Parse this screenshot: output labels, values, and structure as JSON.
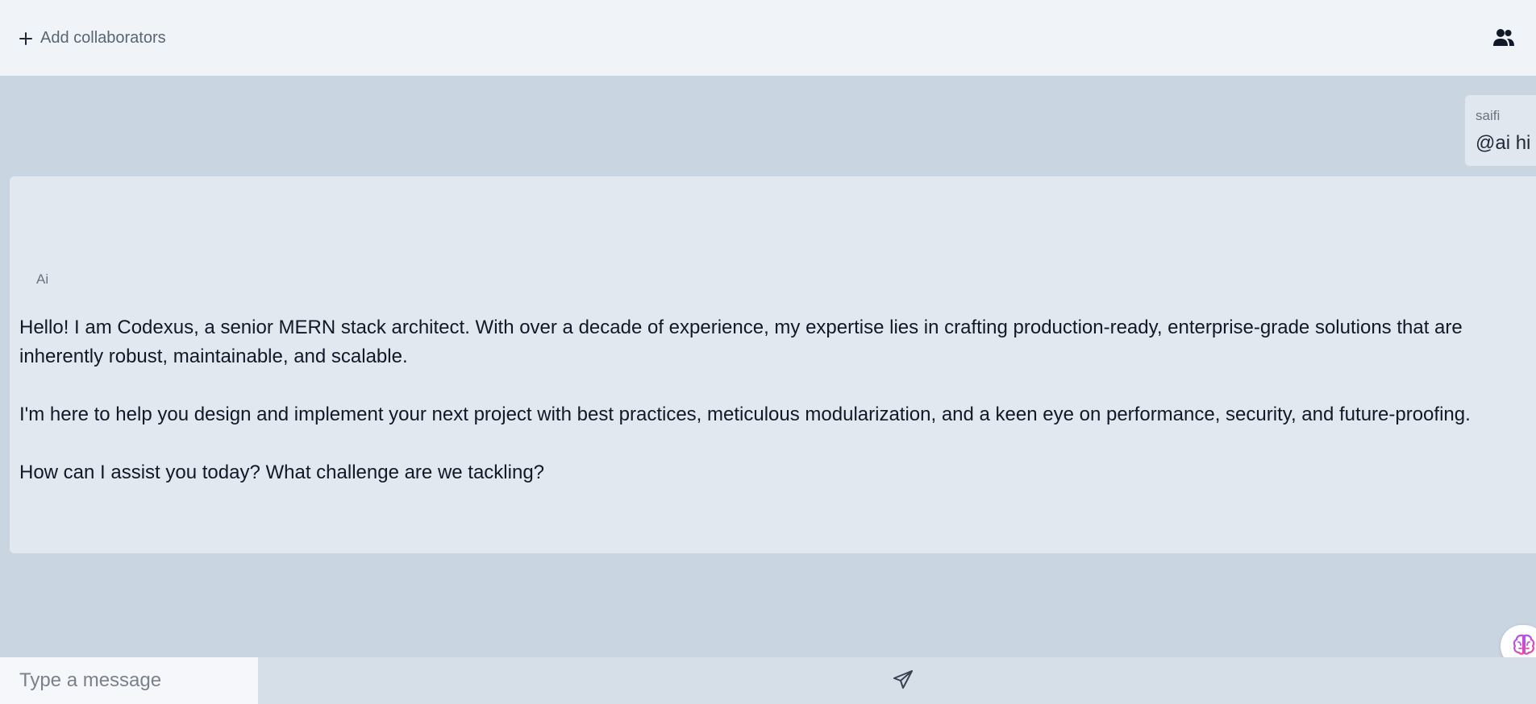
{
  "header": {
    "add_collaborators_label": "Add collaborators",
    "plus_icon": "plus-icon",
    "collaborators_icon": "people-icon"
  },
  "messages": {
    "user_message": {
      "sender": "saifi",
      "text": "@ai hi"
    },
    "ai_message": {
      "sender": "Ai",
      "paragraphs": [
        "Hello! I am Codexus, a senior MERN stack architect. With over a decade of experience, my expertise lies in crafting production-ready, enterprise-grade solutions that are inherently robust, maintainable, and scalable.",
        "I'm here to help you design and implement your next project with best practices, meticulous modularization, and a keen eye on performance, security, and future-proofing.",
        "How can I assist you today? What challenge are we tackling?"
      ]
    }
  },
  "footer": {
    "input_placeholder": "Type a message",
    "input_value": "",
    "send_icon": "send-icon"
  },
  "ai_assistant_icon": "brain-icon",
  "colors": {
    "header_bg": "#f0f4f8",
    "chat_bg": "#c9d5e1",
    "bubble_bg": "#e1e8f0",
    "footer_bg": "#d6dee8"
  }
}
